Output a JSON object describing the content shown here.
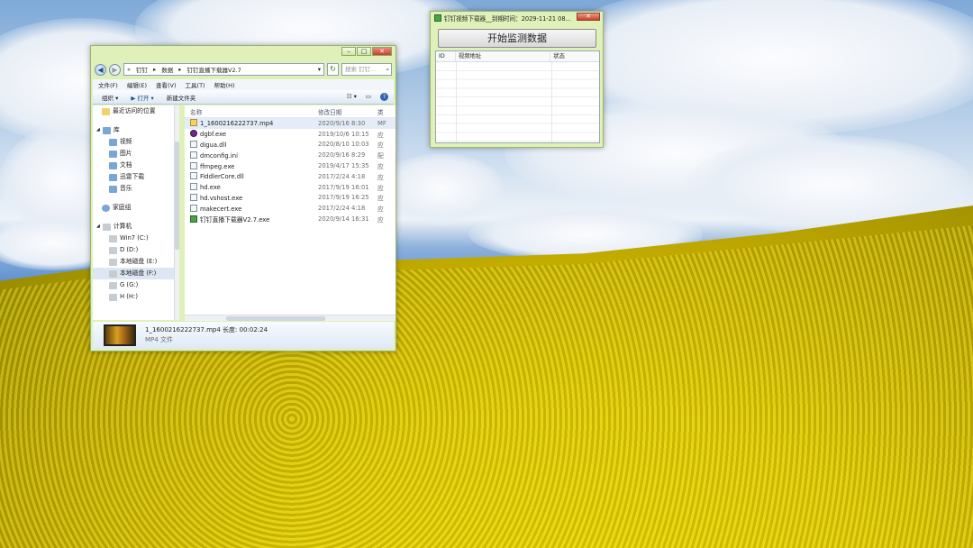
{
  "explorer": {
    "path": [
      "«",
      "钉钉",
      "▸",
      "数据",
      "▸",
      "钉钉直播下载器V2.7"
    ],
    "search_placeholder": "搜索 钉钉...",
    "menu": [
      "文件(F)",
      "编辑(E)",
      "查看(V)",
      "工具(T)",
      "帮助(H)"
    ],
    "toolbar": {
      "organize": "组织 ▾",
      "open": "▶ 打开 ▾",
      "new_folder": "新建文件夹"
    },
    "nav": {
      "recent": "最近访问的位置",
      "libraries": "库",
      "lib_items": [
        "视频",
        "图片",
        "文档",
        "迅雷下载",
        "音乐"
      ],
      "homegroup": "家庭组",
      "computer": "计算机",
      "drives": [
        "Win7 (C:)",
        "D (D:)",
        "本地磁盘 (E:)",
        "本地磁盘 (F:)",
        "G (G:)",
        "H (H:)"
      ]
    },
    "columns": {
      "name": "名称",
      "date": "修改日期",
      "type": "类"
    },
    "files": [
      {
        "name": "1_1600216222737.mp4",
        "date": "2020/9/16 8:30",
        "type": "MF"
      },
      {
        "name": "dgbf.exe",
        "date": "2019/10/6 10:15",
        "type": "应"
      },
      {
        "name": "digua.dll",
        "date": "2020/8/10 10:03",
        "type": "应"
      },
      {
        "name": "dmconfig.ini",
        "date": "2020/9/16 8:29",
        "type": "配"
      },
      {
        "name": "ffmpeg.exe",
        "date": "2019/4/17 15:35",
        "type": "应"
      },
      {
        "name": "FiddlerCore.dll",
        "date": "2017/2/24 4:18",
        "type": "应"
      },
      {
        "name": "hd.exe",
        "date": "2017/9/19 16:01",
        "type": "应"
      },
      {
        "name": "hd.vshost.exe",
        "date": "2017/9/19 16:25",
        "type": "应"
      },
      {
        "name": "makecert.exe",
        "date": "2017/2/24 4:18",
        "type": "应"
      },
      {
        "name": "钉钉直播下载器V2.7.exe",
        "date": "2020/9/14 16:31",
        "type": "应"
      }
    ],
    "details": {
      "filename": "1_1600216222737.mp4",
      "length": "长度: 00:02:24",
      "kind": "MP4 文件"
    }
  },
  "downloader": {
    "title": "钉钉视频下载器__到期时间：2029-11-21 08...",
    "start_button": "开始监测数据",
    "columns": [
      "ID",
      "视频地址",
      "状态"
    ]
  }
}
